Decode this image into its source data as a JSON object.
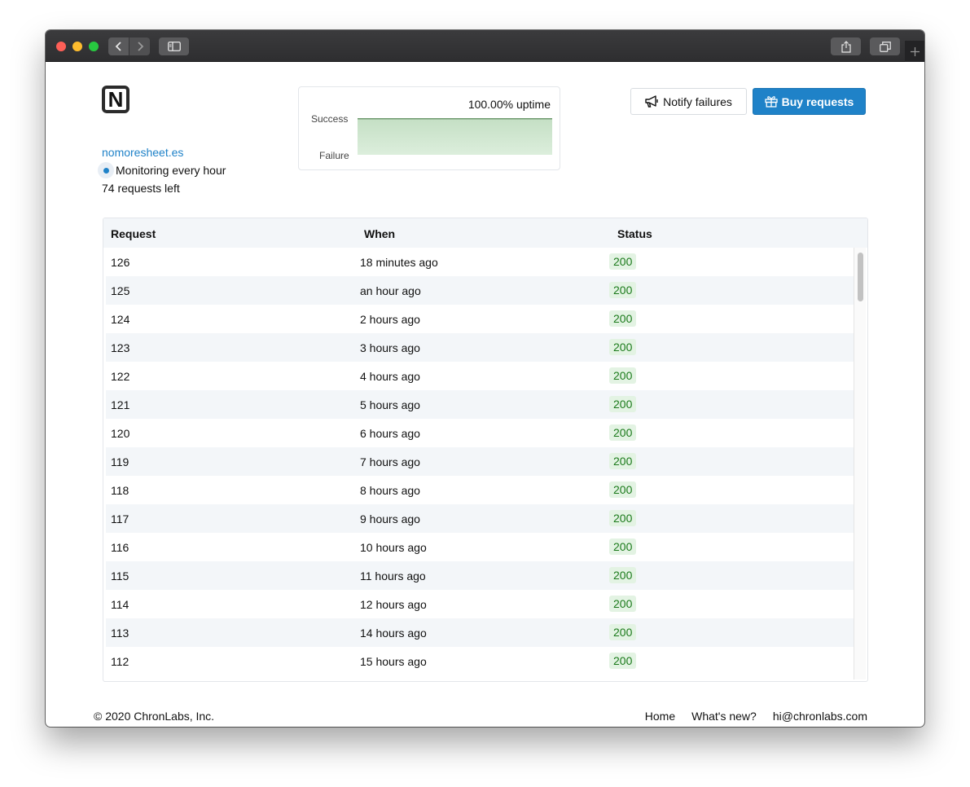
{
  "browser": {
    "icons": [
      "back-icon",
      "forward-icon",
      "sidebar-icon",
      "share-icon",
      "tabs-icon",
      "new-tab-icon"
    ]
  },
  "site": {
    "logo_letter": "N",
    "domain": "nomoresheet.es",
    "monitoring": "Monitoring every hour",
    "requests_left": "74 requests left"
  },
  "uptime": {
    "label": "100.00% uptime",
    "success_label": "Success",
    "failure_label": "Failure",
    "value_percent": 100
  },
  "actions": {
    "notify_label": "Notify failures",
    "notify_icon": "megaphone-icon",
    "buy_label": "Buy requests",
    "buy_icon": "gift-icon"
  },
  "table": {
    "headers": [
      "Request",
      "When",
      "Status"
    ],
    "rows": [
      {
        "id": "126",
        "when": "18 minutes ago",
        "status": "200"
      },
      {
        "id": "125",
        "when": "an hour ago",
        "status": "200"
      },
      {
        "id": "124",
        "when": "2 hours ago",
        "status": "200"
      },
      {
        "id": "123",
        "when": "3 hours ago",
        "status": "200"
      },
      {
        "id": "122",
        "when": "4 hours ago",
        "status": "200"
      },
      {
        "id": "121",
        "when": "5 hours ago",
        "status": "200"
      },
      {
        "id": "120",
        "when": "6 hours ago",
        "status": "200"
      },
      {
        "id": "119",
        "when": "7 hours ago",
        "status": "200"
      },
      {
        "id": "118",
        "when": "8 hours ago",
        "status": "200"
      },
      {
        "id": "117",
        "when": "9 hours ago",
        "status": "200"
      },
      {
        "id": "116",
        "when": "10 hours ago",
        "status": "200"
      },
      {
        "id": "115",
        "when": "11 hours ago",
        "status": "200"
      },
      {
        "id": "114",
        "when": "12 hours ago",
        "status": "200"
      },
      {
        "id": "113",
        "when": "14 hours ago",
        "status": "200"
      },
      {
        "id": "112",
        "when": "15 hours ago",
        "status": "200"
      }
    ]
  },
  "footer": {
    "copyright": "© 2020 ChronLabs, Inc.",
    "links": [
      "Home",
      "What's new?",
      "hi@chronlabs.com"
    ]
  },
  "colors": {
    "accent": "#1f82c8",
    "success_badge_bg": "#e3f3e3",
    "success_badge_text": "#1b7a1b",
    "uptime_fill": "#cfe6cf"
  }
}
